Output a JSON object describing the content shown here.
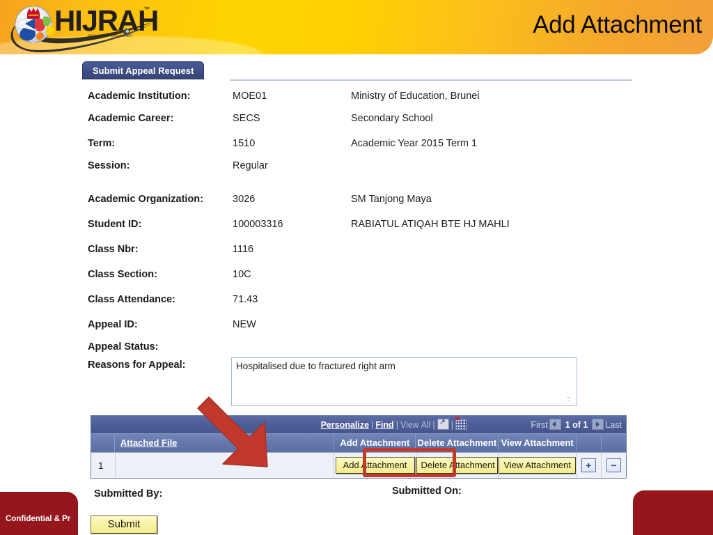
{
  "header": {
    "title": "Add Attachment",
    "logo": {
      "wordmark": "HIJRAH",
      "trademark": "™",
      "tagline": "Ministry of Education"
    }
  },
  "tab": {
    "label": "Submit Appeal Request"
  },
  "form": {
    "rows": [
      {
        "label": "Academic Institution:",
        "value": "MOE01",
        "description": "Ministry of Education, Brunei"
      },
      {
        "label": "Academic Career:",
        "value": "SECS",
        "description": "Secondary School"
      },
      {
        "label": "Term:",
        "value": "1510",
        "description": "Academic Year 2015 Term 1"
      },
      {
        "label": "Session:",
        "value": "Regular",
        "description": ""
      },
      {
        "label": "Academic Organization:",
        "value": "3026",
        "description": "SM Tanjong Maya"
      },
      {
        "label": "Student ID:",
        "value": "100003316",
        "description": "RABIATUL ATIQAH BTE HJ MAHLI"
      },
      {
        "label": "Class Nbr:",
        "value": "1116",
        "description": ""
      },
      {
        "label": "Class Section:",
        "value": "10C",
        "description": ""
      },
      {
        "label": "Class Attendance:",
        "value": "71.43",
        "description": ""
      },
      {
        "label": "Appeal ID:",
        "value": "NEW",
        "description": ""
      },
      {
        "label": "Appeal Status:",
        "value": "",
        "description": ""
      }
    ],
    "reasons": {
      "label": "Reasons for Appeal:",
      "value": "Hospitalised due to fractured right arm",
      "placeholder": ""
    }
  },
  "grid": {
    "toolbar": {
      "personalize": "Personalize",
      "find": "Find",
      "view_all": "View All",
      "download_icon": "download-to-excel-icon",
      "grid_icon": "view-grid-icon",
      "first": "First",
      "prev_icon": "previous-page-icon",
      "page_indicator": "1 of 1",
      "next_icon": "next-page-icon",
      "last": "Last"
    },
    "columns": [
      {
        "key": "rownum",
        "label": ""
      },
      {
        "key": "file",
        "label": "Attached File"
      },
      {
        "key": "add",
        "label": "Add Attachment"
      },
      {
        "key": "delete",
        "label": "Delete Attachment"
      },
      {
        "key": "view",
        "label": "View Attachment"
      },
      {
        "key": "plus",
        "label": ""
      },
      {
        "key": "minus",
        "label": ""
      }
    ],
    "rows": [
      {
        "rownum": "1",
        "file": "",
        "add_button": "Add Attachment",
        "delete_button": "Delete Attachment",
        "view_button": "View Attachment",
        "add_row_button": "+",
        "remove_row_button": "−"
      }
    ]
  },
  "footer": {
    "submitted_by_label": "Submitted By:",
    "submitted_on_label": "Submitted On:",
    "submit_button": "Submit",
    "confidential_note": "Confidential & Pr"
  },
  "annotation": {
    "arrow_target": "Add Attachment",
    "highlight_color": "#c0392b"
  },
  "colors": {
    "banner_yellow": "#ffd200",
    "banner_orange": "#f0a038",
    "tab_blue": "#3e4e86",
    "grid_header_blue": "#6478ad",
    "button_yellow": "#faf3a4",
    "footer_red": "#95171d",
    "annotation_red": "#c0392b"
  }
}
